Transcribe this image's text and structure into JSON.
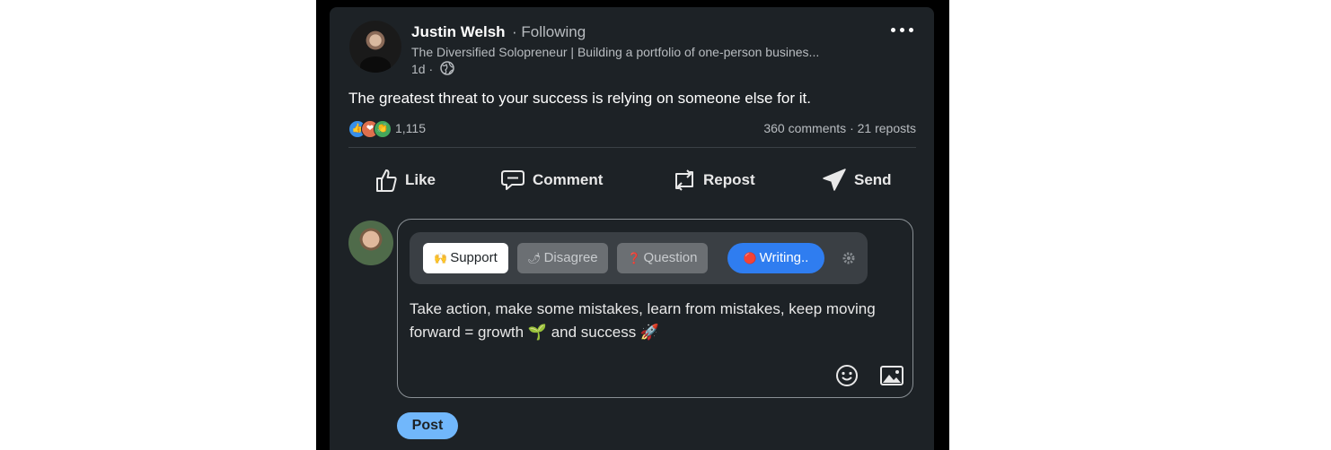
{
  "post": {
    "author": "Justin Welsh",
    "follow_status": "· Following",
    "headline": "The Diversified Solopreneur | Building a portfolio of one-person busines...",
    "time": "1d ·",
    "text": "The greatest threat to your success is relying on someone else for it.",
    "reaction_count": "1,115",
    "stats": "360 comments · 21 reposts"
  },
  "actions": {
    "like": "Like",
    "comment": "Comment",
    "repost": "Repost",
    "send": "Send"
  },
  "composer": {
    "chips": {
      "support": "Support",
      "support_emoji": "🙌",
      "disagree": "Disagree",
      "disagree_emoji": "🌶",
      "question": "Question",
      "question_emoji": "❓",
      "writing": "Writing..",
      "writing_emoji": "🔴"
    },
    "reply_text": "Take action, make some mistakes, learn from mistakes, keep moving forward = growth 🌱 and success 🚀",
    "post_button": "Post"
  },
  "icons": {
    "more": "more-dots-icon",
    "globe": "globe-icon",
    "like": "thumbs-up-icon",
    "comment": "speech-bubble-icon",
    "repost": "repost-arrows-icon",
    "send": "paper-plane-icon",
    "settings": "gear-icon",
    "emoji": "smiley-icon",
    "image": "image-icon"
  },
  "colors": {
    "card_bg": "#1d2226",
    "post_button": "#71b7fb",
    "writing_chip": "#2f7df0",
    "support_chip": "#ffffff",
    "muted_chip": "#6b6f73"
  }
}
